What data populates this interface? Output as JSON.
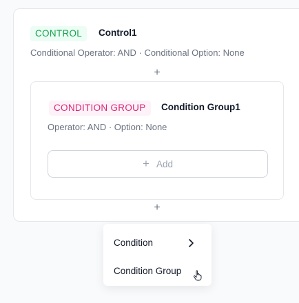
{
  "control": {
    "tag": "CONTROL",
    "name": "Control1",
    "meta": "Conditional Operator: AND · Conditional Option: None",
    "add_symbol": "+"
  },
  "group": {
    "tag": "CONDITION GROUP",
    "name": "Condition Group1",
    "meta": "Operator: AND · Option: None",
    "add_button": {
      "icon": "plus-icon",
      "symbol": "+",
      "label": "Add"
    },
    "add_symbol": "+"
  },
  "menu": {
    "items": [
      {
        "label": "Condition",
        "icon": "chevron-right-icon"
      },
      {
        "label": "Condition Group",
        "icon": "hand-pointer-cursor"
      }
    ]
  },
  "colors": {
    "control_tag_bg": "#ecfdf5",
    "control_tag_text": "#16a34a",
    "group_tag_bg": "#fdf2f8",
    "group_tag_text": "#db2777"
  }
}
